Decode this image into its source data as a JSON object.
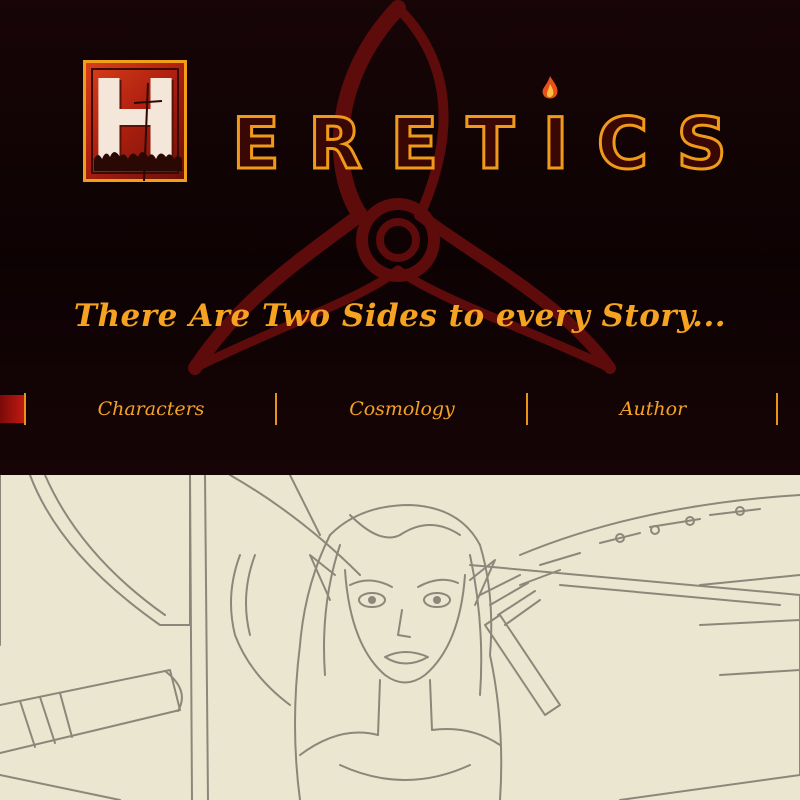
{
  "header": {
    "logo_letter": "H",
    "wordmark_letters": [
      "E",
      "R",
      "E",
      "T",
      "I",
      "C",
      "S"
    ],
    "tagline": "There Are Two Sides to every Story..."
  },
  "nav": {
    "items": [
      {
        "label": "Characters"
      },
      {
        "label": "Cosmology"
      },
      {
        "label": "Author"
      }
    ]
  },
  "colors": {
    "accent_orange": "#f5a320",
    "background_dark": "#0c0203",
    "triquetra_red": "#6a0c0c",
    "logo_red": "#c02a14",
    "sketch_paper": "#ebe6cf"
  },
  "icons": {
    "emblem": "triquetra-icon",
    "flame": "flame-icon"
  }
}
